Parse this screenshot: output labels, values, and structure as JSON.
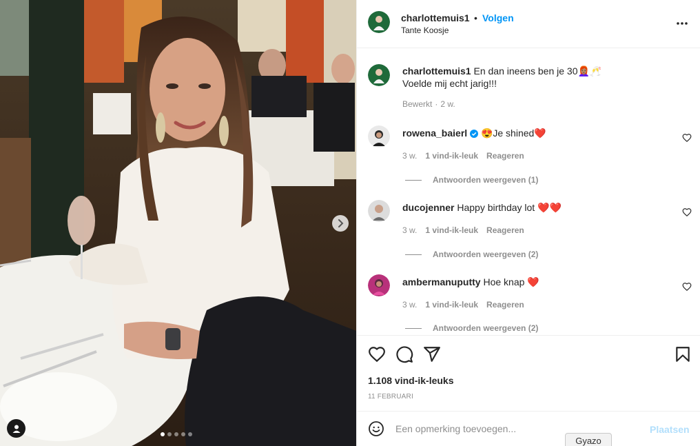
{
  "post": {
    "author": "charlottemuis1",
    "follow_label": "Volgen",
    "location": "Tante Koosje",
    "caption_line1": "En dan ineens ben je 30👩🏽‍🦰🥂",
    "caption_line2": "Voelde mij echt jarig!!!",
    "edited_label": "Bewerkt",
    "edited_time": "2 w.",
    "likes": "1.108 vind-ik-leuks",
    "date": "11 FEBRUARI",
    "carousel": {
      "count": 5,
      "active": 0
    }
  },
  "comments": [
    {
      "user": "rowena_baierl",
      "verified": true,
      "text": "😍Je shined❤️",
      "time": "3 w.",
      "likes": "1 vind-ik-leuk",
      "reply_label": "Reageren",
      "view_replies": "Antwoorden weergeven (1)"
    },
    {
      "user": "ducojenner",
      "verified": false,
      "text": "Happy birthday lot ❤️❤️",
      "time": "3 w.",
      "likes": "1 vind-ik-leuk",
      "reply_label": "Reageren",
      "view_replies": "Antwoorden weergeven (2)"
    },
    {
      "user": "ambermanuputty",
      "verified": false,
      "text": "Hoe knap ❤️",
      "time": "3 w.",
      "likes": "1 vind-ik-leuk",
      "reply_label": "Reageren",
      "view_replies": "Antwoorden weergeven (2)"
    }
  ],
  "composer": {
    "placeholder": "Een opmerking toevoegen...",
    "submit_label": "Plaatsen"
  },
  "tooltip": "Gyazo",
  "icons": {
    "more": "more-horizontal-icon",
    "heart": "heart-icon",
    "comment": "comment-icon",
    "share": "share-icon",
    "save": "bookmark-icon",
    "emoji": "emoji-icon",
    "next": "chevron-right-icon",
    "tag": "user-tag-icon",
    "verified": "verified-badge-icon"
  },
  "colors": {
    "accent": "#0095f6",
    "muted": "#8e8e8e",
    "text": "#262626",
    "post_disabled": "#b2dffc",
    "heart": "#ed4956"
  }
}
